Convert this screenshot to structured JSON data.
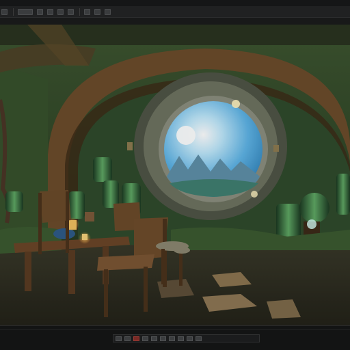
{
  "toolbar": {
    "icons": [
      "app-menu-icon",
      "file-icon",
      "image-icon",
      "layer-icon",
      "brush-icon",
      "color-icon",
      "zoom-icon",
      "view-icon",
      "export-icon"
    ]
  },
  "viewport": {
    "image_description_name": "canvas-image"
  },
  "statusbar": {
    "controls": [
      "prev",
      "frame",
      "record",
      "play",
      "stop",
      "next",
      "loop",
      "timeline",
      "zoom-out",
      "zoom-in"
    ]
  },
  "colors": {
    "window_bg": "#0b0c0c",
    "toolbar_bg": "#202122",
    "statusbar_bg": "#131414",
    "scene_green": "#2f4a2c",
    "scene_wood": "#5a3d24",
    "window_sky": "#8ccff0"
  }
}
